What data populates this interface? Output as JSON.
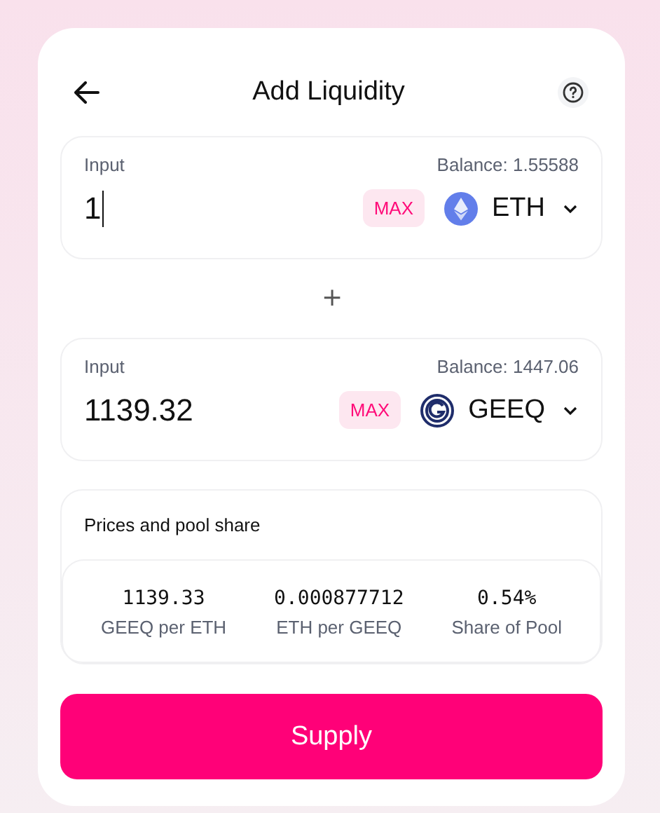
{
  "header": {
    "title": "Add Liquidity"
  },
  "inputs": [
    {
      "label": "Input",
      "balance": "Balance: 1.55588",
      "value": "1",
      "focused": true,
      "max": "MAX",
      "token": {
        "kind": "eth",
        "symbol": "ETH"
      }
    },
    {
      "label": "Input",
      "balance": "Balance: 1447.06",
      "value": "1139.32",
      "focused": false,
      "max": "MAX",
      "token": {
        "kind": "geeq",
        "symbol": "GEEQ"
      }
    }
  ],
  "separator": "+",
  "prices": {
    "title": "Prices and pool share",
    "stats": [
      {
        "value": "1139.33",
        "label": "GEEQ per ETH"
      },
      {
        "value": "0.000877712",
        "label": "ETH per GEEQ"
      },
      {
        "value": "0.54%",
        "label": "Share of Pool"
      }
    ]
  },
  "supply_button": "Supply"
}
